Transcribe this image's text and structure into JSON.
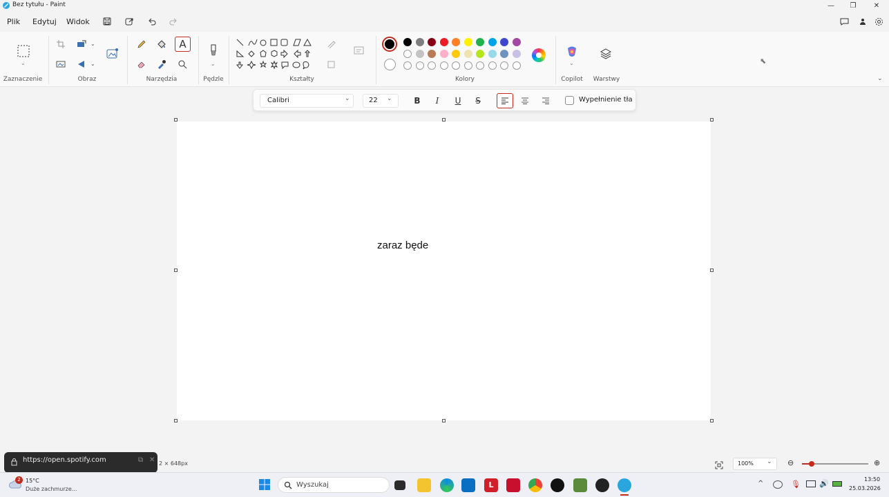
{
  "window": {
    "title": "Bez tytułu - Paint"
  },
  "menu": {
    "file": "Plik",
    "edit": "Edytuj",
    "view": "Widok"
  },
  "ribbon": {
    "groups": {
      "selection": "Zaznaczenie",
      "image": "Obraz",
      "tools": "Narzędzia",
      "brushes": "Pędzle",
      "shapes": "Kształty",
      "colors": "Kolory",
      "copilot": "Copilot",
      "layers": "Warstwy"
    },
    "palette_row1": [
      "#000000",
      "#7f7f7f",
      "#880015",
      "#ed1c24",
      "#ff7f27",
      "#fff200",
      "#22b14c",
      "#00a2e8",
      "#3f48cc",
      "#a349a4"
    ],
    "palette_row2": [
      "#ffffff",
      "#c3c3c3",
      "#b97a57",
      "#ffaec9",
      "#ffc90e",
      "#efe4b0",
      "#b5e61d",
      "#99d9ea",
      "#7092be",
      "#c8bfe7"
    ],
    "active_color": "#000000",
    "accent": "#c42b1c"
  },
  "text_toolbar": {
    "font": "Calibri",
    "size": "22",
    "bold": "B",
    "italic": "I",
    "underline": "U",
    "strike": "S",
    "fill_label": "Wypełnienie tła"
  },
  "canvas": {
    "text": "zaraz będe"
  },
  "status": {
    "dimensions": "2 × 648px",
    "zoom": "100%"
  },
  "toast": {
    "url": "https://open.spotify.com"
  },
  "taskbar": {
    "weather_temp": "15°C",
    "weather_desc": "Duże zachmurze...",
    "weather_badge": "2",
    "search_placeholder": "Wyszukaj",
    "time": "13:50",
    "date": "25.03.2026"
  }
}
